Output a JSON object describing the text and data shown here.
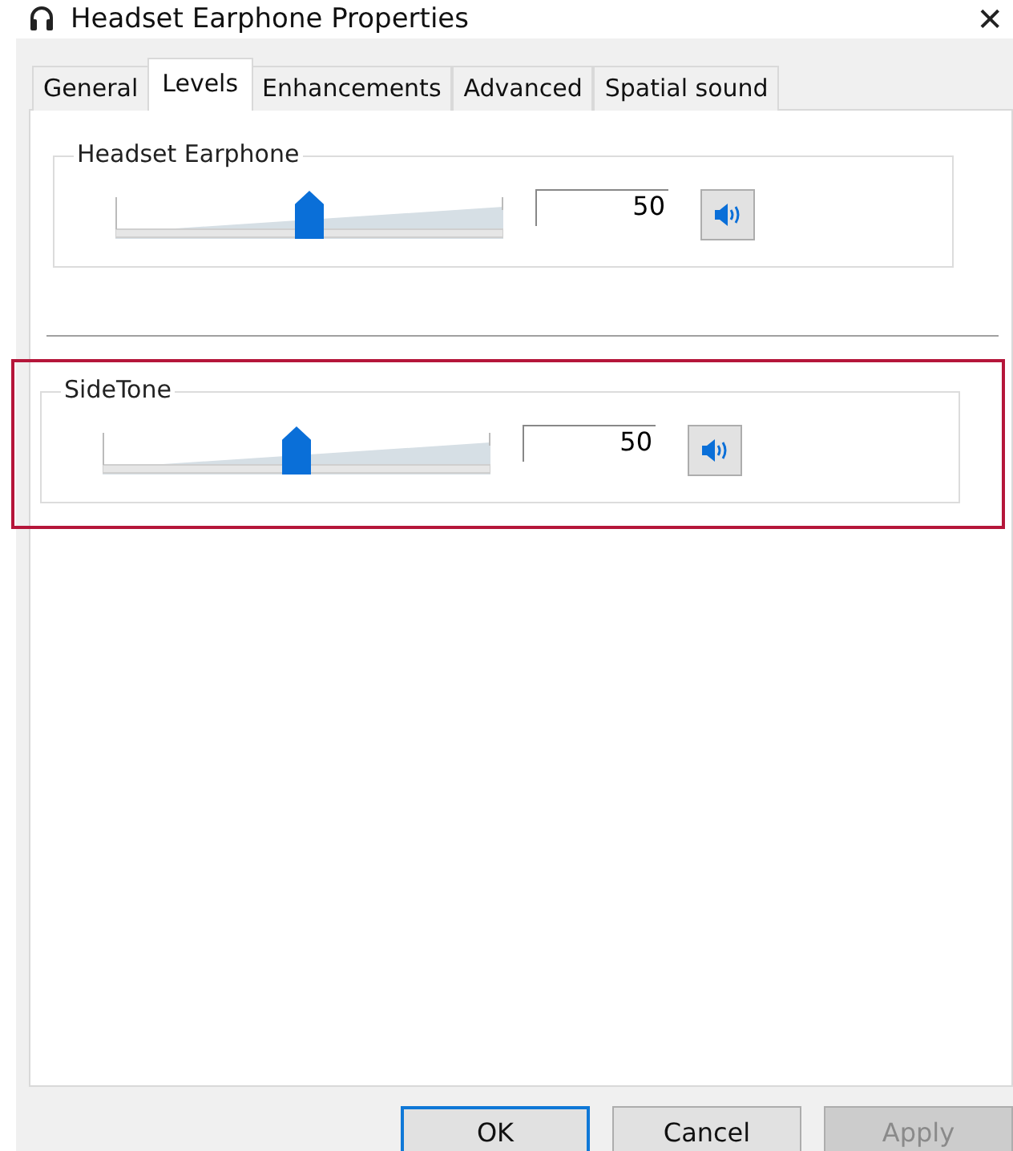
{
  "window": {
    "title": "Headset Earphone Properties",
    "close": "✕"
  },
  "tabs": [
    {
      "label": "General",
      "selected": false
    },
    {
      "label": "Levels",
      "selected": true
    },
    {
      "label": "Enhancements",
      "selected": false
    },
    {
      "label": "Advanced",
      "selected": false
    },
    {
      "label": "Spatial sound",
      "selected": false
    }
  ],
  "channels": [
    {
      "name": "Headset Earphone",
      "level": 0.5,
      "value": "50",
      "muted": false,
      "highlighted": false
    },
    {
      "name": "SideTone",
      "level": 0.5,
      "value": "50",
      "muted": false,
      "highlighted": true
    }
  ],
  "buttons": [
    {
      "label": "OK",
      "kind": "default",
      "disabled": false
    },
    {
      "label": "Cancel",
      "kind": "normal",
      "disabled": false
    },
    {
      "label": "Apply",
      "kind": "normal",
      "disabled": true
    }
  ]
}
